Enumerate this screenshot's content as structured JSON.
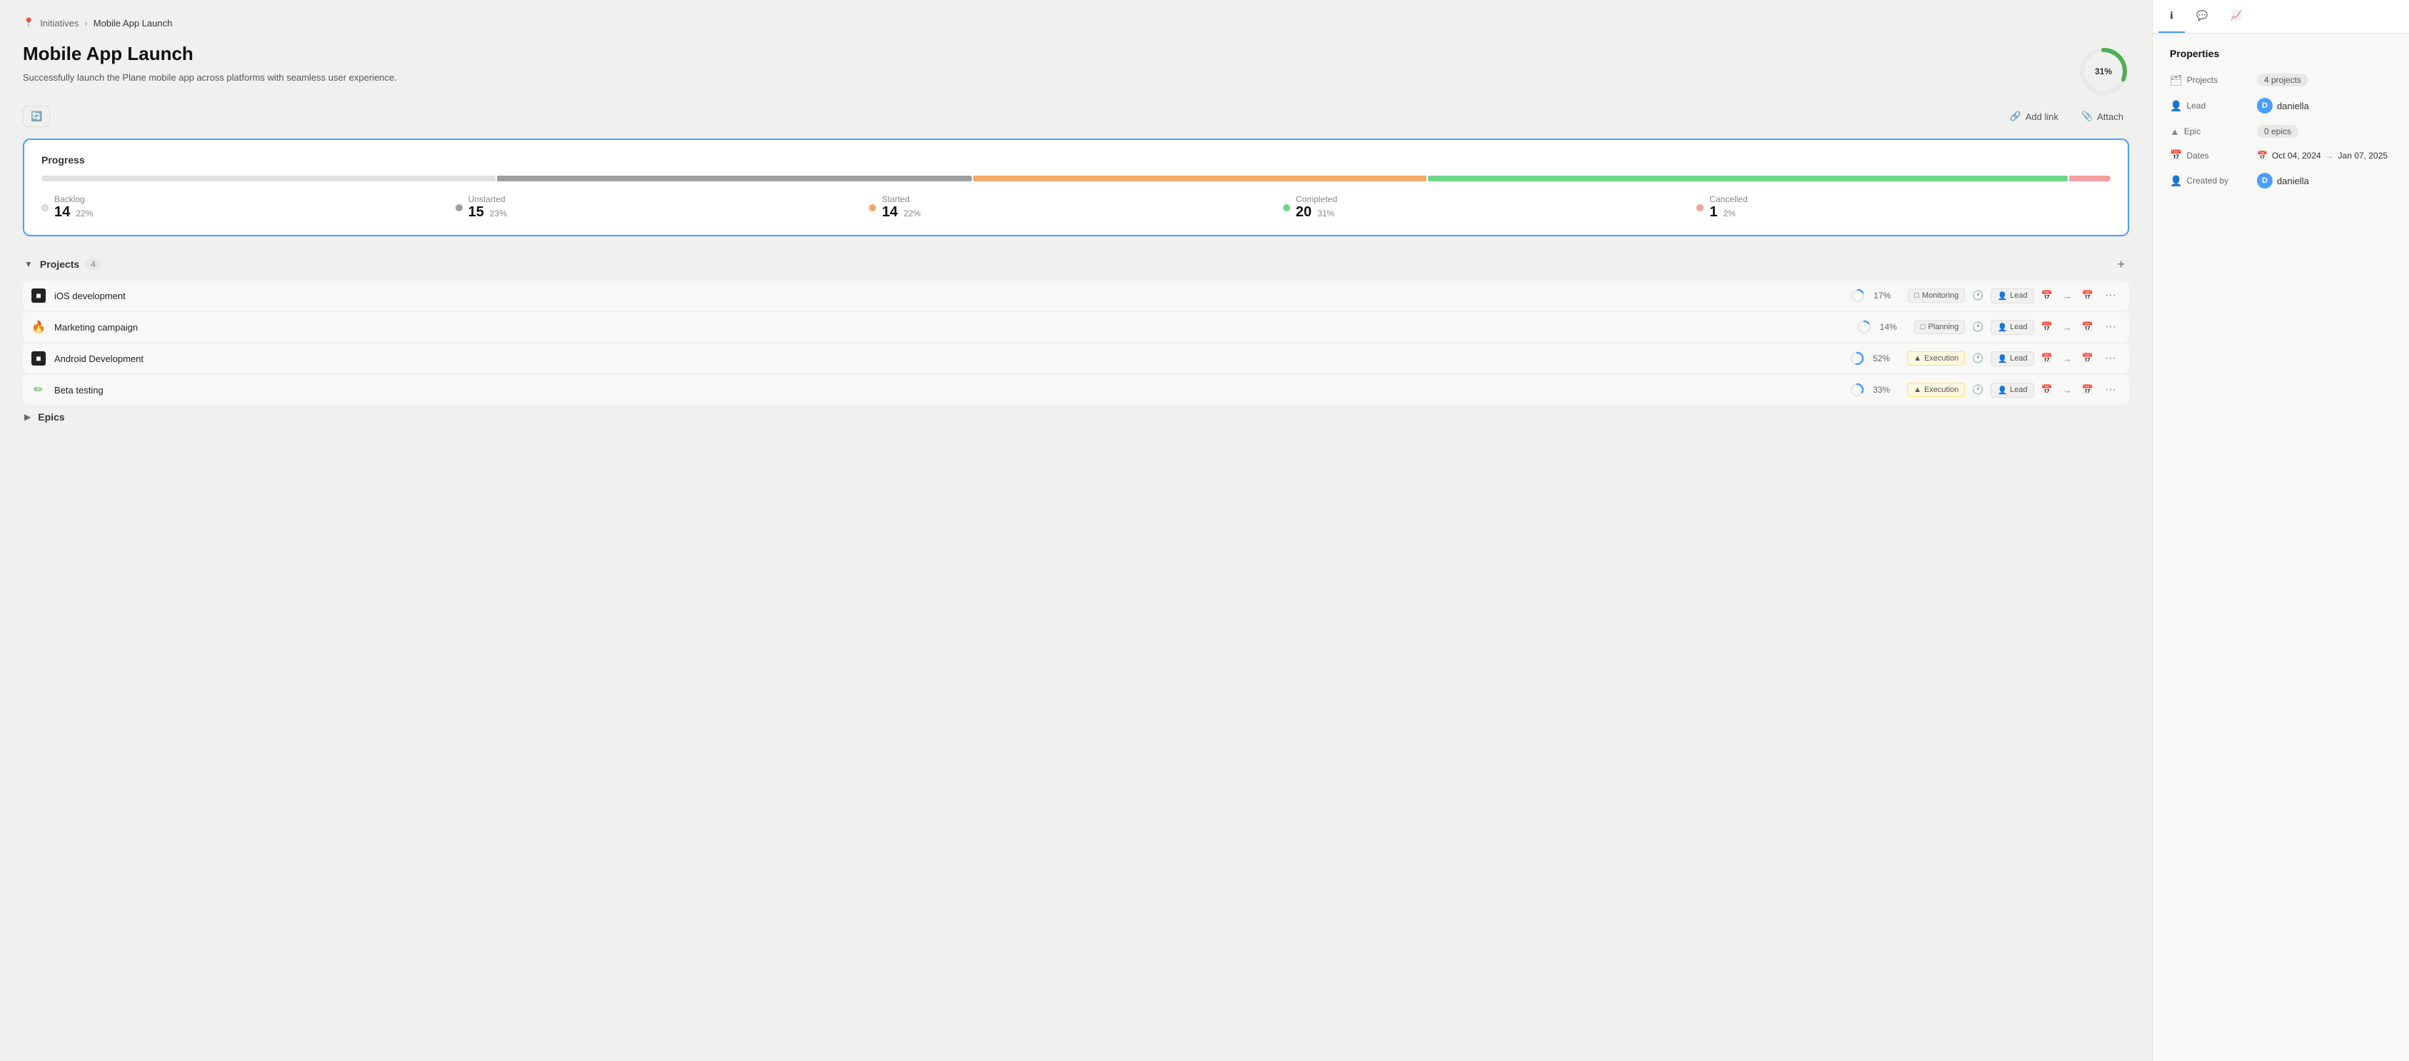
{
  "breadcrumb": {
    "parent": "Initiatives",
    "current": "Mobile App Launch"
  },
  "page": {
    "title": "Mobile App Launch",
    "description": "Successfully launch the Plane mobile app across platforms with seamless user experience.",
    "progress_pct": "31%"
  },
  "toolbar": {
    "add_link": "Add link",
    "attach": "Attach"
  },
  "progress": {
    "title": "Progress",
    "segments": [
      {
        "label": "Backlog",
        "pct": 22,
        "color": "#e0e0e0"
      },
      {
        "label": "Unstarted",
        "pct": 23,
        "color": "#9e9e9e"
      },
      {
        "label": "Started",
        "pct": 22,
        "color": "#f4a96a"
      },
      {
        "label": "Completed",
        "pct": 31,
        "color": "#6dd68a"
      },
      {
        "label": "Cancelled",
        "pct": 2,
        "color": "#f4a0a0"
      }
    ],
    "stats": [
      {
        "label": "Backlog",
        "count": "14",
        "pct": "22%",
        "color": "#e0e0e0"
      },
      {
        "label": "Unstarted",
        "count": "15",
        "pct": "23%",
        "color": "#9e9e9e"
      },
      {
        "label": "Started",
        "count": "14",
        "pct": "22%",
        "color": "#f4a96a"
      },
      {
        "label": "Completed",
        "count": "20",
        "pct": "31%",
        "color": "#6dd68a"
      },
      {
        "label": "Cancelled",
        "count": "1",
        "pct": "2%",
        "color": "#f4a0a0"
      }
    ]
  },
  "projects": {
    "title": "Projects",
    "count": "4",
    "items": [
      {
        "name": "iOS development",
        "icon": "■",
        "icon_color": "#111",
        "pct": "17%",
        "pct_num": 17,
        "status": "Monitoring",
        "status_bg": "#f0f0ee"
      },
      {
        "name": "Marketing campaign",
        "icon": "🔥",
        "icon_color": "#f90",
        "pct": "14%",
        "pct_num": 14,
        "status": "Planning",
        "status_bg": "#f0f0ee"
      },
      {
        "name": "Android Development",
        "icon": "■",
        "icon_color": "#111",
        "pct": "52%",
        "pct_num": 52,
        "status": "Execution",
        "status_bg": "#fff8e1"
      },
      {
        "name": "Beta testing",
        "icon": "✏",
        "icon_color": "#4caf50",
        "pct": "33%",
        "pct_num": 33,
        "status": "Execution",
        "status_bg": "#fff8e1"
      }
    ]
  },
  "epics": {
    "title": "Epics"
  },
  "sidebar": {
    "tabs": [
      "info",
      "comment",
      "activity"
    ],
    "properties_title": "Properties",
    "properties": {
      "projects_label": "Projects",
      "projects_value": "4 projects",
      "lead_label": "Lead",
      "lead_value": "daniella",
      "epic_label": "Epic",
      "epic_value": "0 epics",
      "dates_label": "Dates",
      "date_start": "Oct 04, 2024",
      "date_end": "Jan 07, 2025",
      "created_by_label": "Created by",
      "created_by_value": "daniella"
    }
  }
}
